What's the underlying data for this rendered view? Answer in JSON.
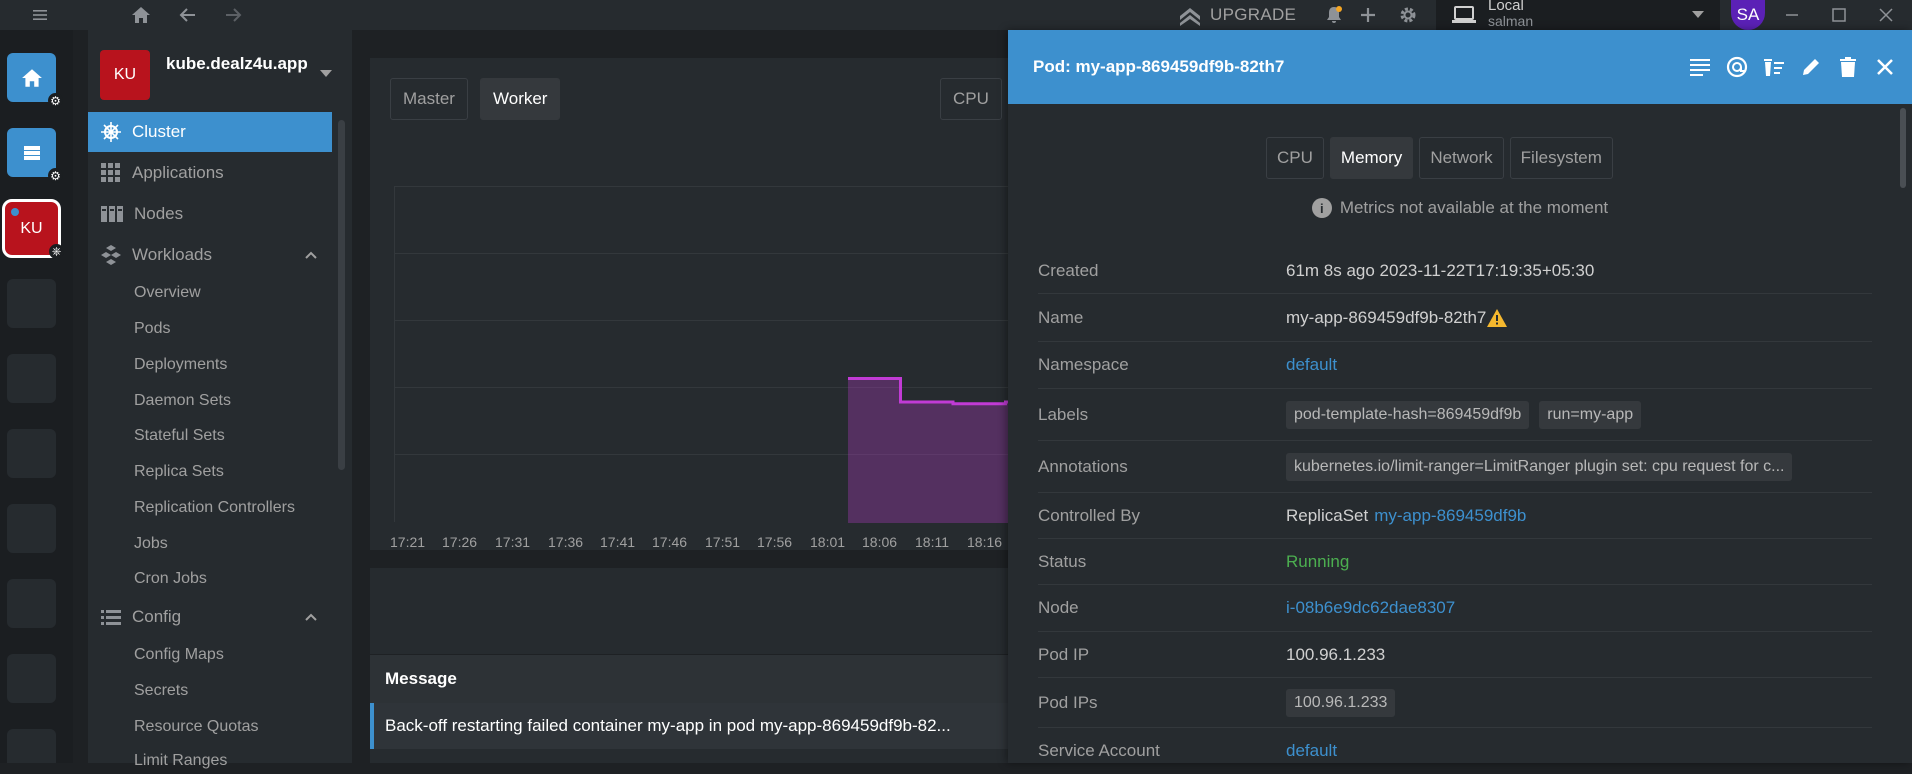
{
  "window": {
    "upgrade_label": "UPGRADE",
    "context_name": "Local",
    "context_user": "salman",
    "avatar": "SA"
  },
  "hotbar": {
    "cluster_badge": "KU"
  },
  "sidebar": {
    "cluster_initials": "KU",
    "cluster_name": "kube.dealz4u.app",
    "items": [
      {
        "label": "Cluster",
        "icon": "helm-icon"
      },
      {
        "label": "Applications",
        "icon": "grid-icon"
      },
      {
        "label": "Nodes",
        "icon": "nodes-icon"
      },
      {
        "label": "Workloads",
        "icon": "workloads-icon"
      }
    ],
    "workloads_sub": [
      "Overview",
      "Pods",
      "Deployments",
      "Daemon Sets",
      "Stateful Sets",
      "Replica Sets",
      "Replication Controllers",
      "Jobs",
      "Cron Jobs"
    ],
    "config_label": "Config",
    "config_sub": [
      "Config Maps",
      "Secrets",
      "Resource Quotas",
      "Limit Ranges"
    ]
  },
  "overview": {
    "tabs": [
      "Master",
      "Worker"
    ],
    "right_tab": "CPU",
    "xticks": [
      "17:21",
      "17:26",
      "17:31",
      "17:36",
      "17:41",
      "17:46",
      "17:51",
      "17:56",
      "18:01",
      "18:06",
      "18:11",
      "18:16"
    ],
    "events_header": "Message",
    "event_message": "Back-off restarting failed container my-app in pod my-app-869459df9b-82..."
  },
  "chart_data": {
    "type": "area",
    "x": [
      "17:21",
      "17:26",
      "17:31",
      "17:36",
      "17:41",
      "17:46",
      "17:51",
      "17:56",
      "18:01",
      "18:06",
      "18:11",
      "18:16"
    ],
    "series": [
      {
        "values": [
          null,
          null,
          null,
          null,
          null,
          null,
          null,
          null,
          0.43,
          0.36,
          0.355,
          0.36
        ]
      }
    ],
    "grid": true,
    "color": "#c13bd5"
  },
  "drawer": {
    "title": "Pod: my-app-869459df9b-82th7",
    "metric_tabs": [
      "CPU",
      "Memory",
      "Network",
      "Filesystem"
    ],
    "active_metric_tab": "Memory",
    "metrics_note": "Metrics not available at the moment",
    "rows": {
      "created_k": "Created",
      "created_v": "61m 8s ago 2023-11-22T17:19:35+05:30",
      "name_k": "Name",
      "name_v": "my-app-869459df9b-82th7",
      "namespace_k": "Namespace",
      "namespace_v": "default",
      "labels_k": "Labels",
      "label1": "pod-template-hash=869459df9b",
      "label2": "run=my-app",
      "annotations_k": "Annotations",
      "annotation1": "kubernetes.io/limit-ranger=LimitRanger plugin set: cpu request for c...",
      "controlled_k": "Controlled By",
      "controlled_kind": "ReplicaSet",
      "controlled_v": "my-app-869459df9b",
      "status_k": "Status",
      "status_v": "Running",
      "node_k": "Node",
      "node_v": "i-08b6e9dc62dae8307",
      "podip_k": "Pod IP",
      "podip_v": "100.96.1.233",
      "podips_k": "Pod IPs",
      "podips_v": "100.96.1.233",
      "sa_k": "Service Account",
      "sa_v": "default"
    },
    "colors": {
      "accent": "#3d90ce",
      "running": "#4caf50",
      "warning": "#f5b82e"
    }
  }
}
